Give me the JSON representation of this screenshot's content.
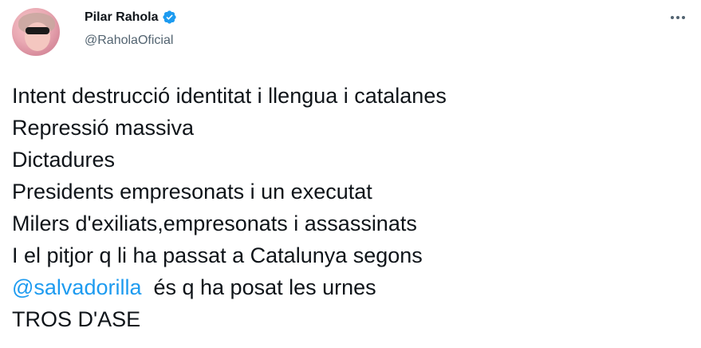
{
  "author": {
    "name": "Pilar Rahola",
    "handle": "@RaholaOficial",
    "verified_icon": "verified-badge-icon",
    "accent_color": "#1d9bf0"
  },
  "menu": {
    "icon": "more-icon"
  },
  "tweet": {
    "lines": [
      "Intent destrucció identitat i llengua i catalanes",
      "Repressió massiva",
      "Dictadures",
      "Presidents empresonats i un executat",
      "Milers d'exiliats,empresonats i assassinats",
      "I el pitjor q li ha passat a Catalunya segons"
    ],
    "mention": "@salvadorilla",
    "mention_rest": "  és q ha posat les urnes",
    "last_line": "TROS D'ASE"
  }
}
